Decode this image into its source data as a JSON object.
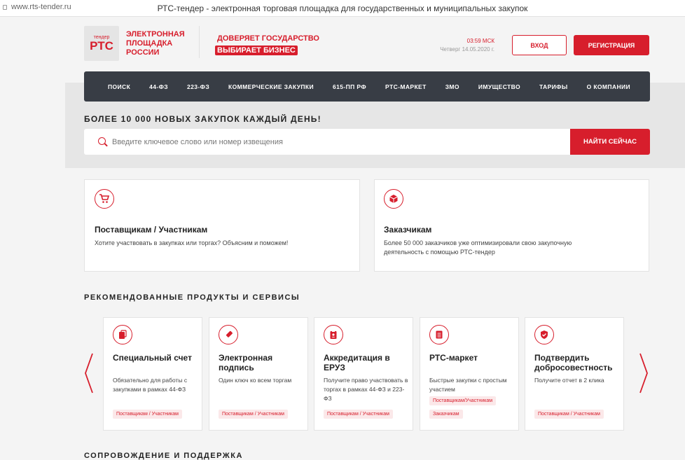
{
  "browser": {
    "url": "www.rts-tender.ru",
    "tab_title": "РТС-тендер - электронная торговая площадка для государственных и муниципальных закупок"
  },
  "header": {
    "logo_small": "тендер",
    "logo_big": "РТС",
    "logo_text_1": "ЭЛЕКТРОННАЯ",
    "logo_text_2": "ПЛОЩАДКА",
    "logo_text_3": "РОССИИ",
    "slogan_1": "ДОВЕРЯЕТ ГОСУДАРСТВО",
    "slogan_2": "ВЫБИРАЕТ БИЗНЕС",
    "time": "03:59 МСК",
    "date": "Четверг 14.05.2020 г.",
    "login_label": "ВХОД",
    "register_label": "РЕГИСТРАЦИЯ"
  },
  "nav": [
    "ПОИСК",
    "44-ФЗ",
    "223-ФЗ",
    "КОММЕРЧЕСКИЕ ЗАКУПКИ",
    "615-ПП РФ",
    "РТС-МАРКЕТ",
    "ЗМО",
    "ИМУЩЕСТВО",
    "ТАРИФЫ",
    "О КОМПАНИИ"
  ],
  "hero": {
    "title": "БОЛЕЕ 10 000 НОВЫХ ЗАКУПОК КАЖДЫЙ ДЕНЬ!",
    "search_placeholder": "Введите ключевое слово или номер извещения",
    "search_button": "НАЙТИ СЕЙЧАС"
  },
  "audience_cards": [
    {
      "title": "Поставщикам / Участникам",
      "text": "Хотите участвовать в закупках или торгах? Объясним и поможем!",
      "icon": "cart-icon"
    },
    {
      "title": "Заказчикам",
      "text": "Более 50 000 заказчиков уже оптимизировали свою закупочную деятельность с помощью РТС-тендер",
      "icon": "box-icon"
    }
  ],
  "products_section_title": "РЕКОМЕНДОВАННЫЕ ПРОДУКТЫ И СЕРВИСЫ",
  "products": [
    {
      "title": "Специальный счет",
      "text": "Обязательно для работы с закупками в рамках 44-ФЗ",
      "tags": [
        "Поставщикам / Участникам"
      ],
      "icon": "wallet-icon"
    },
    {
      "title": "Электронная подпись",
      "text": "Один ключ ко всем торгам",
      "tags": [
        "Поставщикам / Участникам"
      ],
      "icon": "usb-key-icon"
    },
    {
      "title": "Аккредитация в ЕРУЗ",
      "text": "Получите право участвовать в торгах в рамках 44-ФЗ и 223-ФЗ",
      "tags": [
        "Поставщикам / Участникам"
      ],
      "icon": "badge-icon"
    },
    {
      "title": "РТС-маркет",
      "text": "Быстрые закупки с простым участием",
      "tags": [
        "Поставщикам/Участникам",
        "Заказчикам"
      ],
      "icon": "list-icon"
    },
    {
      "title": "Подтвердить добросовестность",
      "text": "Получите отчет в 2 клика",
      "tags": [
        "Поставщикам / Участникам"
      ],
      "icon": "shield-check-icon"
    }
  ],
  "next_section_title": "СОПРОВОЖДЕНИЕ И ПОДДЕРЖКА",
  "colors": {
    "accent": "#d71e2c",
    "nav_bg": "#383d45",
    "page_bg": "#f4f4f4"
  }
}
